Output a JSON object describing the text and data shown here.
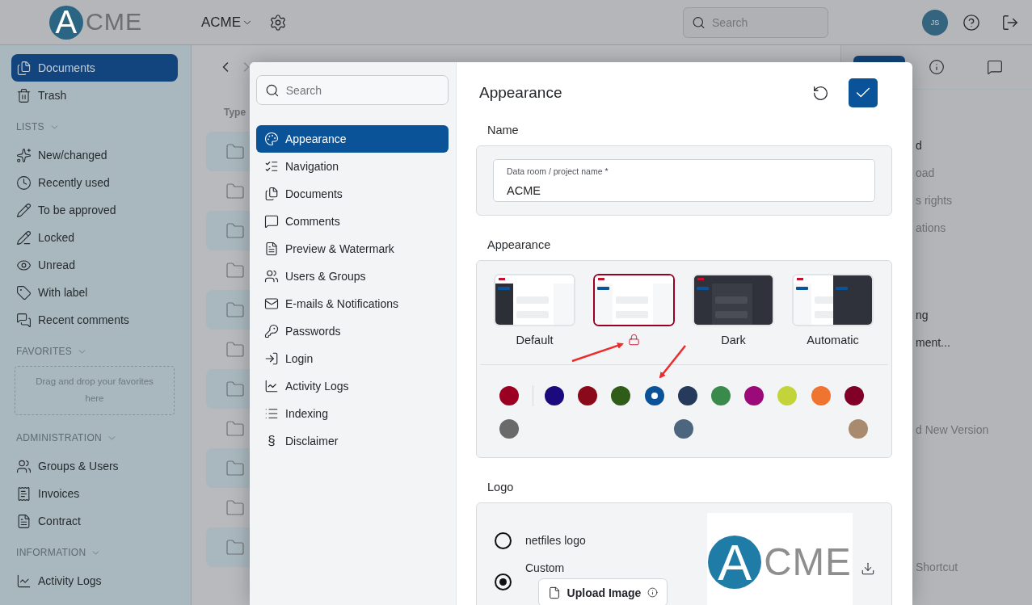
{
  "header": {
    "logo": {
      "letter": "A",
      "rest": "CME"
    },
    "room": {
      "label": "ACME"
    },
    "search": {
      "placeholder": "Search"
    },
    "avatar": {
      "initials": "JS"
    }
  },
  "sidebar": {
    "items": [
      {
        "label": "Documents",
        "selected": true
      },
      {
        "label": "Trash",
        "selected": false
      }
    ],
    "sections": [
      {
        "title": "LISTS",
        "items": [
          {
            "label": "New/changed",
            "selected": false
          },
          {
            "label": "Recently used",
            "selected": false
          },
          {
            "label": "To be approved",
            "selected": false
          },
          {
            "label": "Locked",
            "selected": false
          },
          {
            "label": "Unread",
            "selected": false
          },
          {
            "label": "With label",
            "selected": false
          },
          {
            "label": "Recent comments",
            "selected": false
          }
        ]
      },
      {
        "title": "FAVORITES",
        "dropzone": "Drag and drop your favorites here"
      },
      {
        "title": "ADMINISTRATION",
        "items": [
          {
            "label": "Groups & Users",
            "selected": false
          },
          {
            "label": "Invoices",
            "selected": false
          },
          {
            "label": "Contract",
            "selected": false
          }
        ]
      },
      {
        "title": "INFORMATION",
        "items": [
          {
            "label": "Activity Logs",
            "selected": false
          }
        ]
      }
    ]
  },
  "main": {
    "column_header": "Type",
    "rows": [
      {
        "highlighted": true
      },
      {
        "highlighted": false
      },
      {
        "highlighted": true
      },
      {
        "highlighted": false
      },
      {
        "highlighted": true
      },
      {
        "highlighted": false
      },
      {
        "highlighted": true
      },
      {
        "highlighted": false
      },
      {
        "highlighted": true
      },
      {
        "highlighted": false
      },
      {
        "highlighted": true
      }
    ]
  },
  "right_panel": {
    "groups": [
      {
        "items": [
          {
            "text": "d",
            "kind": "heading"
          },
          {
            "text": "oad",
            "kind": "action"
          },
          {
            "text": "s rights",
            "kind": "action"
          },
          {
            "text": "ations",
            "kind": "action"
          }
        ]
      },
      {
        "items": [
          {
            "text": "ng",
            "kind": "heading"
          },
          {
            "text": "ment...",
            "kind": "heading"
          }
        ]
      },
      {
        "items": [
          {
            "text": "d New Version",
            "kind": "action"
          }
        ]
      },
      {
        "items": [
          {
            "text": "Shortcut",
            "kind": "action"
          }
        ]
      }
    ]
  },
  "dialog": {
    "search": {
      "placeholder": "Search"
    },
    "nav": [
      {
        "label": "Appearance",
        "selected": true
      },
      {
        "label": "Navigation",
        "selected": false
      },
      {
        "label": "Documents",
        "selected": false
      },
      {
        "label": "Comments",
        "selected": false
      },
      {
        "label": "Preview & Watermark",
        "selected": false
      },
      {
        "label": "Users & Groups",
        "selected": false
      },
      {
        "label": "E-mails & Notifications",
        "selected": false
      },
      {
        "label": "Passwords",
        "selected": false
      },
      {
        "label": "Login",
        "selected": false
      },
      {
        "label": "Activity Logs",
        "selected": false
      },
      {
        "label": "Indexing",
        "selected": false
      },
      {
        "label": "Disclaimer",
        "selected": false,
        "glyph": "§"
      }
    ],
    "title": "Appearance",
    "name_section": {
      "title": "Name",
      "field": {
        "label": "Data room / project name *",
        "value": "ACME"
      }
    },
    "appearance_section": {
      "title": "Appearance",
      "themes": [
        {
          "kind": "default",
          "label": "Default",
          "selected": false,
          "locked": false
        },
        {
          "kind": "light",
          "selected": true,
          "locked": true
        },
        {
          "kind": "dark",
          "label": "Dark",
          "selected": false,
          "locked": false
        },
        {
          "kind": "automatic",
          "label": "Automatic",
          "selected": false,
          "locked": false
        }
      ],
      "colors": {
        "brand": {
          "color": "#9b0022",
          "selected": false
        },
        "palette": [
          {
            "color": "#1a0a7d",
            "selected": false
          },
          {
            "color": "#8b0a1a",
            "selected": false
          },
          {
            "color": "#2f5c18",
            "selected": false
          },
          {
            "color": "#0b5399",
            "selected": true
          },
          {
            "color": "#263a5c",
            "selected": false
          },
          {
            "color": "#3a8a4c",
            "selected": false
          },
          {
            "color": "#9b0a78",
            "selected": false
          },
          {
            "color": "#c2d43a",
            "selected": false
          },
          {
            "color": "#ee7430",
            "selected": false
          },
          {
            "color": "#800028",
            "selected": false
          }
        ],
        "extra": [
          {
            "color": "#6a6a6a",
            "selected": false
          },
          {
            "color": "#4d6680",
            "selected": false
          },
          {
            "color": "#a88a6e",
            "selected": false
          }
        ]
      }
    },
    "logo_section": {
      "title": "Logo",
      "options": [
        {
          "label": "netfiles logo",
          "selected": false
        },
        {
          "label": "Custom",
          "selected": true
        }
      ],
      "upload_button": "Upload Image",
      "preview": {
        "letter": "A",
        "rest": "CME"
      }
    }
  }
}
